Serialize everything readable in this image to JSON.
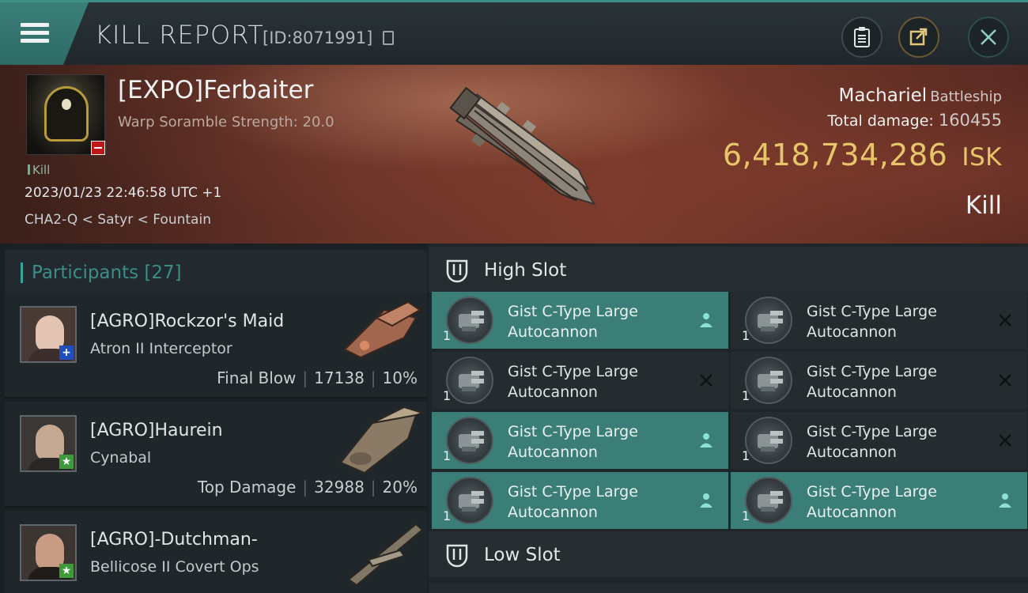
{
  "titlebar": {
    "title": "KILL REPORT",
    "id_label": "[ID:8071991]",
    "icons": [
      "menu-icon",
      "copy-icon",
      "clipboard-icon",
      "share-icon",
      "close-icon"
    ]
  },
  "victim": {
    "name": "[EXPO]Ferbaiter",
    "scramble": "Warp Soramble Strength: 20.0",
    "tag": "Kill",
    "datetime": "2023/01/23 22:46:58 UTC +1",
    "location": "CHA2-Q < Satyr < Fountain",
    "ship_name": "Machariel",
    "ship_class": "Battleship",
    "total_damage_label": "Total damage:",
    "total_damage": "160455",
    "isk_value": "6,418,734,286",
    "isk_unit": "ISK",
    "result": "Kill",
    "colors": {
      "isk": "#e7c56a",
      "standing_badge": "#c01818"
    }
  },
  "participants": {
    "header": "Participants [27]",
    "rows": [
      {
        "name": "[AGRO]Rockzor's Maid",
        "ship": "Atron II Interceptor",
        "role": "Final Blow",
        "damage": "17138",
        "percent": "10%",
        "badge": "+",
        "badge_color": "#1f4fbf"
      },
      {
        "name": "[AGRO]Haurein",
        "ship": "Cynabal",
        "role": "Top Damage",
        "damage": "32988",
        "percent": "20%",
        "badge": "★",
        "badge_color": "#3e9a3a"
      },
      {
        "name": "[AGRO]-Dutchman-",
        "ship": "Bellicose II Covert Ops",
        "badge": "★",
        "badge_color": "#3e9a3a"
      }
    ]
  },
  "fitting": {
    "high_slot_label": "High Slot",
    "low_slot_label": "Low Slot",
    "modules": [
      {
        "line1": "Gist C-Type Large",
        "line2": "Autocannon",
        "qty": "1",
        "state": "dropped"
      },
      {
        "line1": "Gist C-Type Large",
        "line2": "Autocannon",
        "qty": "1",
        "state": "destroyed"
      },
      {
        "line1": "Gist C-Type Large",
        "line2": "Autocannon",
        "qty": "1",
        "state": "destroyed"
      },
      {
        "line1": "Gist C-Type Large",
        "line2": "Autocannon",
        "qty": "1",
        "state": "destroyed"
      },
      {
        "line1": "Gist C-Type Large",
        "line2": "Autocannon",
        "qty": "1",
        "state": "dropped"
      },
      {
        "line1": "Gist C-Type Large",
        "line2": "Autocannon",
        "qty": "1",
        "state": "destroyed"
      },
      {
        "line1": "Gist C-Type Large",
        "line2": "Autocannon",
        "qty": "1",
        "state": "dropped"
      },
      {
        "line1": "Gist C-Type Large",
        "line2": "Autocannon",
        "qty": "1",
        "state": "dropped"
      }
    ],
    "colors": {
      "dropped": "#3a7e77",
      "destroyed": "#252c30"
    }
  }
}
